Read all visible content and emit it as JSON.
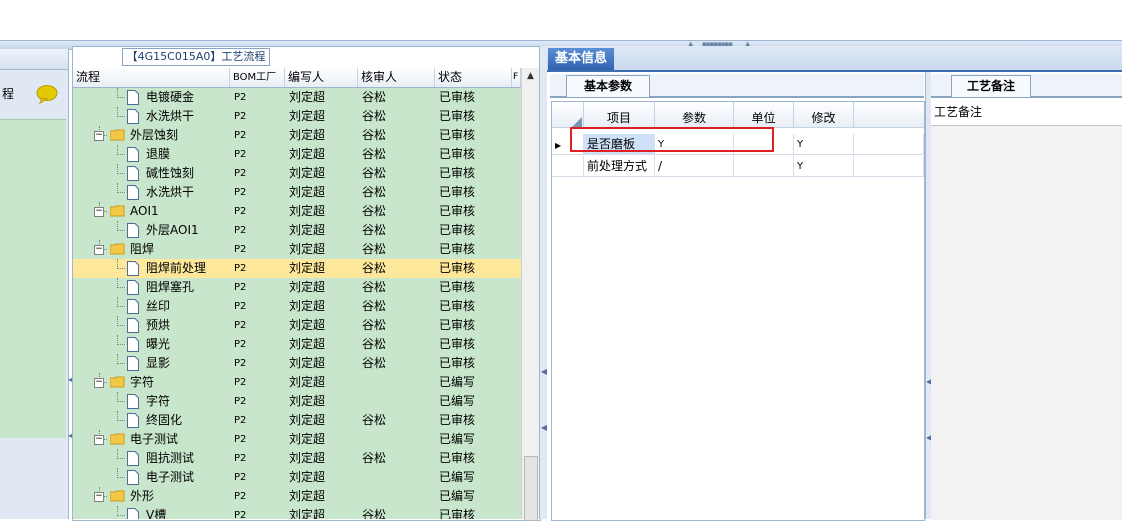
{
  "left_strip": {
    "label": "程"
  },
  "tree": {
    "title": "【4G15C015A0】工艺流程",
    "columns": [
      "流程",
      "BOM工厂",
      "编写人",
      "核审人",
      "状态",
      "F"
    ],
    "rows": [
      {
        "name": "电镀硬金",
        "bom": "P2",
        "author": "刘定超",
        "reviewer": "谷松",
        "status": "已审核",
        "level": 2,
        "icon": "doc"
      },
      {
        "name": "水洗烘干",
        "bom": "P2",
        "author": "刘定超",
        "reviewer": "谷松",
        "status": "已审核",
        "level": 2,
        "icon": "doc"
      },
      {
        "name": "外层蚀刻",
        "bom": "P2",
        "author": "刘定超",
        "reviewer": "谷松",
        "status": "已审核",
        "level": 1,
        "icon": "folder"
      },
      {
        "name": "退膜",
        "bom": "P2",
        "author": "刘定超",
        "reviewer": "谷松",
        "status": "已审核",
        "level": 2,
        "icon": "doc"
      },
      {
        "name": "碱性蚀刻",
        "bom": "P2",
        "author": "刘定超",
        "reviewer": "谷松",
        "status": "已审核",
        "level": 2,
        "icon": "doc"
      },
      {
        "name": "水洗烘干",
        "bom": "P2",
        "author": "刘定超",
        "reviewer": "谷松",
        "status": "已审核",
        "level": 2,
        "icon": "doc"
      },
      {
        "name": "AOI1",
        "bom": "P2",
        "author": "刘定超",
        "reviewer": "谷松",
        "status": "已审核",
        "level": 1,
        "icon": "folder"
      },
      {
        "name": "外层AOI1",
        "bom": "P2",
        "author": "刘定超",
        "reviewer": "谷松",
        "status": "已审核",
        "level": 2,
        "icon": "doc"
      },
      {
        "name": "阻焊",
        "bom": "P2",
        "author": "刘定超",
        "reviewer": "谷松",
        "status": "已审核",
        "level": 1,
        "icon": "folder"
      },
      {
        "name": "阻焊前处理",
        "bom": "P2",
        "author": "刘定超",
        "reviewer": "谷松",
        "status": "已审核",
        "level": 2,
        "icon": "doc",
        "selected": true
      },
      {
        "name": "阻焊塞孔",
        "bom": "P2",
        "author": "刘定超",
        "reviewer": "谷松",
        "status": "已审核",
        "level": 2,
        "icon": "doc"
      },
      {
        "name": "丝印",
        "bom": "P2",
        "author": "刘定超",
        "reviewer": "谷松",
        "status": "已审核",
        "level": 2,
        "icon": "doc"
      },
      {
        "name": "预烘",
        "bom": "P2",
        "author": "刘定超",
        "reviewer": "谷松",
        "status": "已审核",
        "level": 2,
        "icon": "doc"
      },
      {
        "name": "曝光",
        "bom": "P2",
        "author": "刘定超",
        "reviewer": "谷松",
        "status": "已审核",
        "level": 2,
        "icon": "doc"
      },
      {
        "name": "显影",
        "bom": "P2",
        "author": "刘定超",
        "reviewer": "谷松",
        "status": "已审核",
        "level": 2,
        "icon": "doc"
      },
      {
        "name": "字符",
        "bom": "P2",
        "author": "刘定超",
        "reviewer": "",
        "status": "已编写",
        "level": 1,
        "icon": "folder"
      },
      {
        "name": "字符",
        "bom": "P2",
        "author": "刘定超",
        "reviewer": "",
        "status": "已编写",
        "level": 2,
        "icon": "doc"
      },
      {
        "name": "终固化",
        "bom": "P2",
        "author": "刘定超",
        "reviewer": "谷松",
        "status": "已审核",
        "level": 2,
        "icon": "doc"
      },
      {
        "name": "电子测试",
        "bom": "P2",
        "author": "刘定超",
        "reviewer": "",
        "status": "已编写",
        "level": 1,
        "icon": "folder"
      },
      {
        "name": "阻抗测试",
        "bom": "P2",
        "author": "刘定超",
        "reviewer": "谷松",
        "status": "已审核",
        "level": 2,
        "icon": "doc"
      },
      {
        "name": "电子测试",
        "bom": "P2",
        "author": "刘定超",
        "reviewer": "",
        "status": "已编写",
        "level": 2,
        "icon": "doc"
      },
      {
        "name": "外形",
        "bom": "P2",
        "author": "刘定超",
        "reviewer": "",
        "status": "已编写",
        "level": 1,
        "icon": "folder"
      },
      {
        "name": "V槽",
        "bom": "P2",
        "author": "刘定超",
        "reviewer": "谷松",
        "status": "已审核",
        "level": 2,
        "icon": "doc"
      }
    ]
  },
  "basic_info": {
    "tab_label": "基本信息",
    "params_tab_label": "基本参数",
    "columns": [
      "项目",
      "参数",
      "单位",
      "修改"
    ],
    "rows": [
      {
        "item": "是否磨板",
        "param": "Y",
        "unit": "",
        "modify": "Y"
      },
      {
        "item": "前处理方式",
        "param": "/",
        "unit": "",
        "modify": "Y"
      }
    ]
  },
  "notes": {
    "tab_label": "工艺备注",
    "label": "工艺备注"
  },
  "colors": {
    "tree_bg": "#c8e6cc",
    "selected_row": "#fde79b",
    "tab_active": "#2f63b0",
    "highlight": "#e02020"
  }
}
